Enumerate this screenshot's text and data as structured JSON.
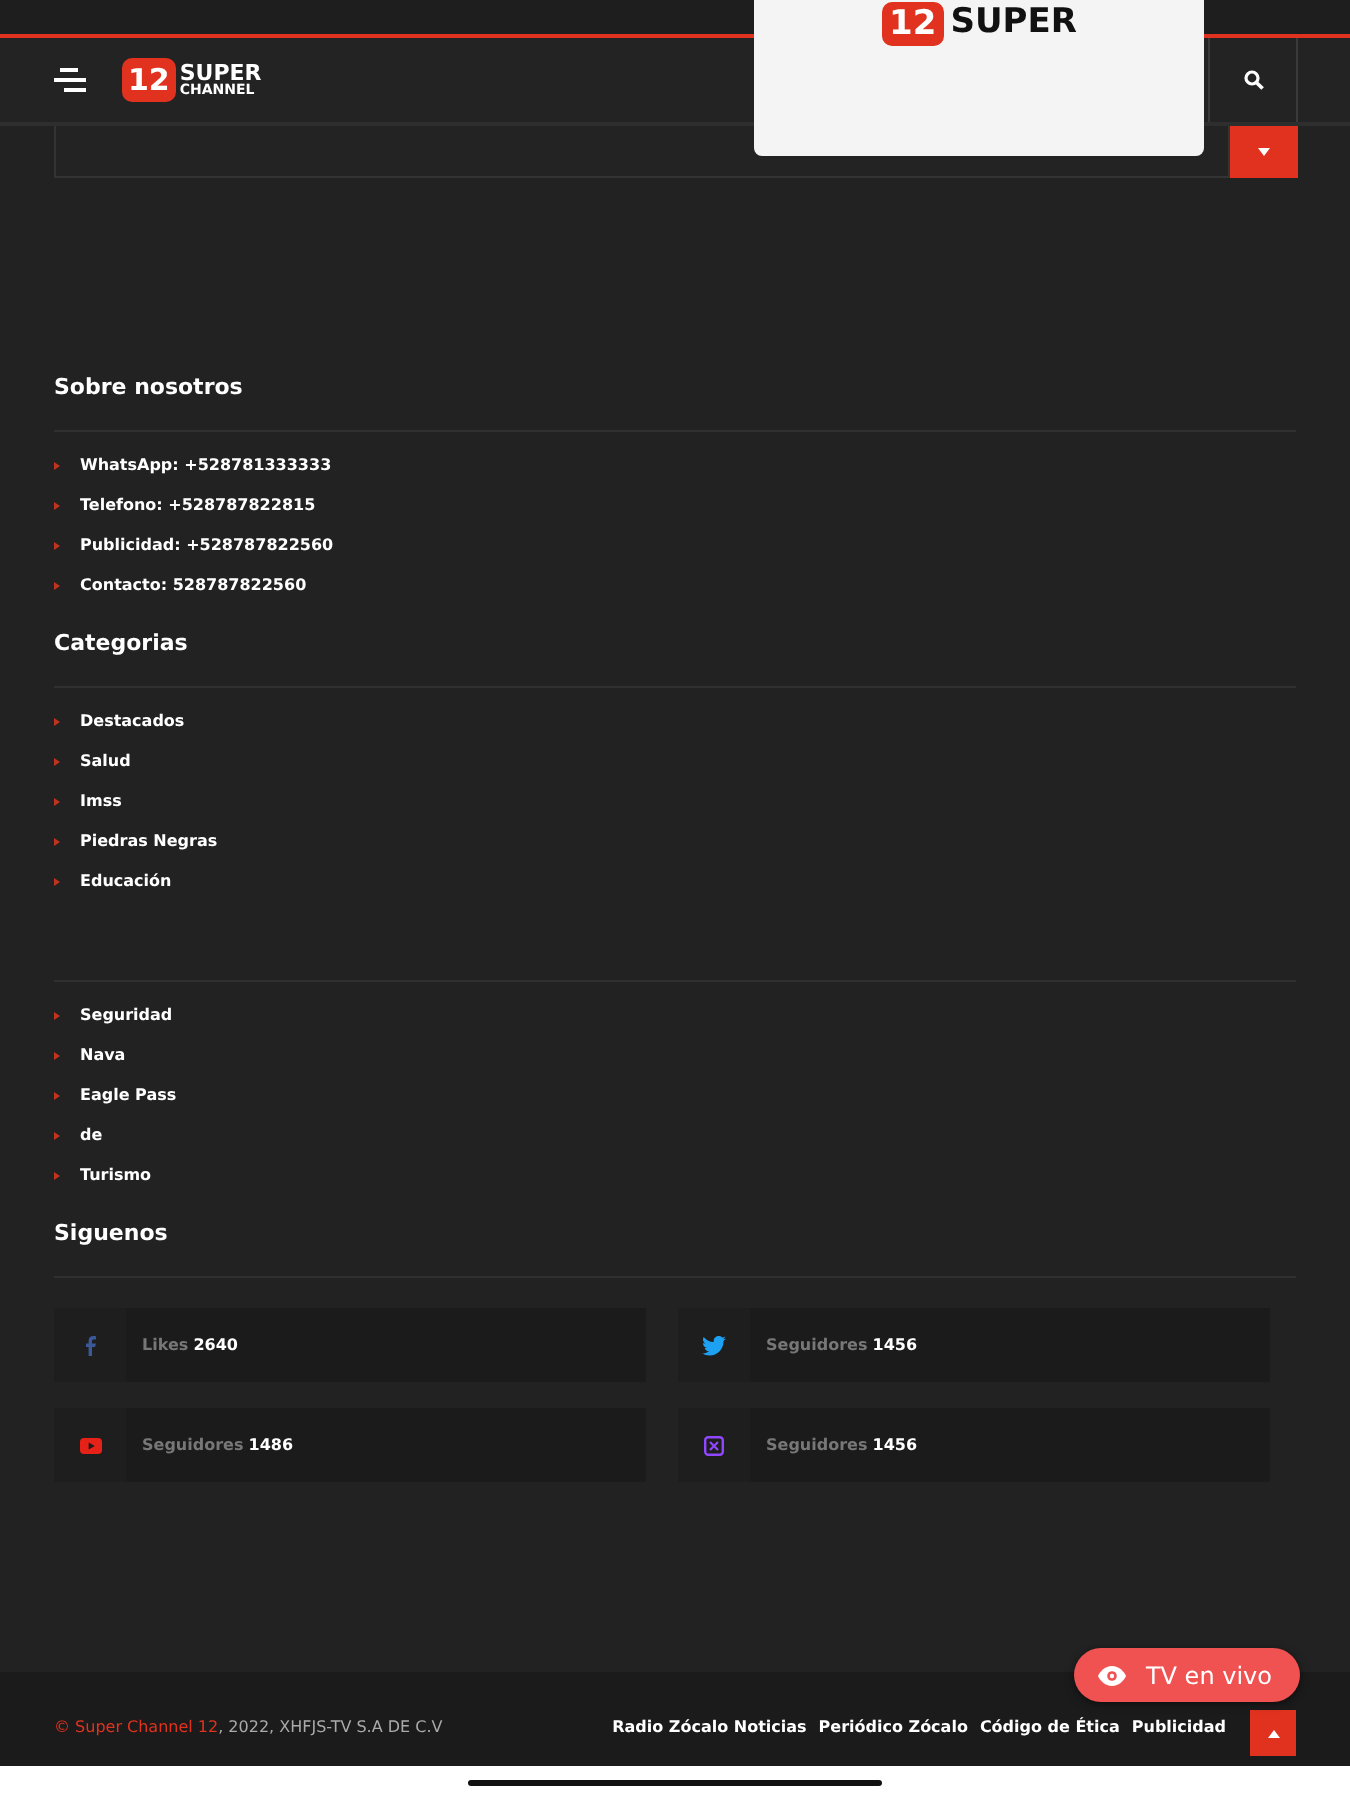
{
  "header": {
    "logo_number": "12",
    "logo_top": "SUPER",
    "logo_bottom": "CHANNEL"
  },
  "ad": {
    "logo_number": "12",
    "logo_word": "SUPER"
  },
  "about": {
    "title": "Sobre nosotros",
    "items": [
      "WhatsApp: +528781333333",
      "Telefono: +528787822815",
      "Publicidad: +528787822560",
      "Contacto: 528787822560"
    ]
  },
  "categories": {
    "title": "Categorias",
    "items": [
      "Destacados",
      "Salud",
      "Imss",
      "Piedras Negras",
      "Educación"
    ]
  },
  "more_categories": {
    "items": [
      "Seguridad",
      "Nava",
      "Eagle Pass",
      "de",
      "Turismo"
    ]
  },
  "follow": {
    "title": "Siguenos",
    "cards": [
      {
        "kind": "facebook",
        "label": "Likes",
        "count": "2640",
        "color": "#3b5998"
      },
      {
        "kind": "twitter",
        "label": "Seguidores",
        "count": "1456",
        "color": "#1da1f2"
      },
      {
        "kind": "youtube",
        "label": "Seguidores",
        "count": "1486",
        "color": "#e62117"
      },
      {
        "kind": "twitch",
        "label": "Seguidores",
        "count": "1456",
        "color": "#9146ff"
      }
    ]
  },
  "footer": {
    "brand": "© Super Channel 12",
    "rest": ", 2022, XHFJS-TV S.A DE C.V",
    "links": [
      "Radio Zócalo Noticias",
      "Periódico Zócalo",
      "Código de Ética",
      "Publicidad"
    ]
  },
  "live_button": {
    "label": "TV en vivo"
  }
}
